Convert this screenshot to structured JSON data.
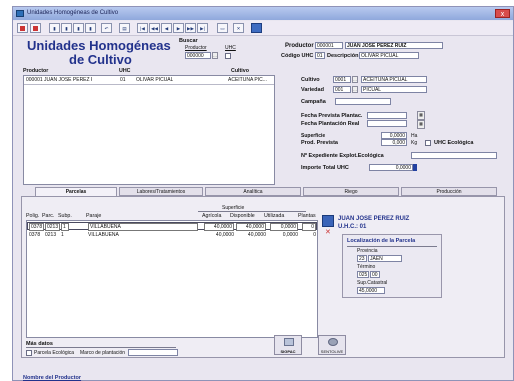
{
  "window": {
    "title": "Unidades Homogéneas de Cultivo",
    "close": "x"
  },
  "toolbar": [
    "",
    "",
    "",
    "",
    "",
    "",
    "",
    "",
    "",
    "",
    "",
    "",
    "",
    "",
    "",
    "",
    "",
    ""
  ],
  "header": {
    "title_line1": "Unidades Homogéneas",
    "title_line2": "de Cultivo",
    "buscar_label": "Buscar",
    "buscar_productor": "Productor",
    "buscar_uhc": "UHC",
    "buscar_value": "000000"
  },
  "producer": {
    "productor_label": "Productor",
    "productor_code": "000001",
    "productor_name": "JUAN JOSE PEREZ RUIZ",
    "codigo_uhc_label": "Código UHC",
    "codigo_uhc": "01",
    "descripcion_label": "Descripción",
    "descripcion": "OLIVAR PICUAL"
  },
  "list": {
    "headers": [
      "Productor",
      "UHC",
      "Cultivo"
    ],
    "rows": [
      [
        "000001",
        "JUAN JOSE PEREZ R...",
        "01",
        "OLIVAR PICUAL",
        "ACEITUNA PIC..."
      ]
    ]
  },
  "details": {
    "cultivo_label": "Cultivo",
    "cultivo_code": "0001",
    "cultivo_name": "ACEITUNA PICUAL",
    "variedad_label": "Variedad",
    "variedad_code": "001",
    "variedad_name": "PICUAL",
    "campana_label": "Campaña",
    "fecha_prevista_label": "Fecha Prevista Plantac.",
    "fecha_plantacion_label": "Fecha Plantación Real",
    "superficie_label": "Superficie",
    "superficie_value": "0,0000",
    "superficie_unit": "Ha",
    "prod_prevista_label": "Prod. Prevista",
    "prod_prevista_value": "0,000",
    "prod_prevista_unit": "Kg",
    "uhc_ecologica_label": "UHC Ecológica",
    "expediente_label": "Nº Expediente Explot.Ecológica",
    "importe_label": "Importe Total UHC",
    "importe_value": "0,0000"
  },
  "tabs": [
    "Parcelas",
    "Labores/Tratamientos",
    "Analítica",
    "Riego",
    "Producción"
  ],
  "parcelas": {
    "superficie_group": "Superficie",
    "headers": [
      "Polig.",
      "Parc.",
      "Subp.",
      "Paraje",
      "Agrícola",
      "Disponible",
      "Utilizada",
      "Plantas"
    ],
    "rows": [
      [
        "0378",
        "0213",
        "1",
        "VILLABUENA",
        "40,0000",
        "40,0000",
        "0,0000",
        "0"
      ],
      [
        "0378",
        "0213",
        "1",
        "VILLABUENA",
        "40,0000",
        "40,0000",
        "0,0000",
        "0"
      ]
    ],
    "producer_name": "JUAN JOSE PEREZ RUIZ",
    "uhc_label": "U.H.C.: 01",
    "localizacion_title": "Localización de la Parcela",
    "provincia_label": "Provincia",
    "provincia_code": "23",
    "provincia_name": "JAEN",
    "termino_label": "Término",
    "termino_code": "025",
    "termino_name": "00",
    "sup_catastral_label": "Sup.Catastral",
    "sup_catastral_value": "45,0000",
    "mas_datos_label": "Más datos",
    "parcela_ecologica_label": "Parcela Ecológica",
    "marco_label": "Marco de plantación",
    "btn1_label": "SIGPAC",
    "btn2_label": "SENTOLIVE"
  },
  "footer": {
    "label": "Nombre del Productor"
  }
}
